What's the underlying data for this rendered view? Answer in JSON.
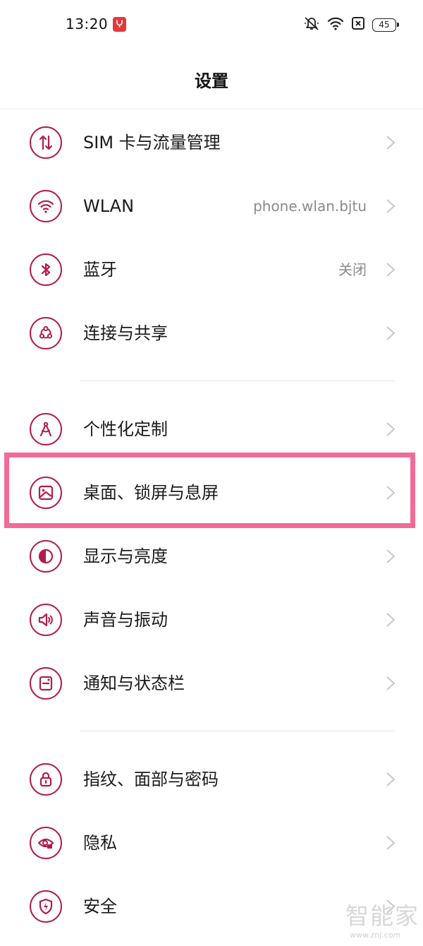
{
  "status_bar": {
    "time": "13:20",
    "battery": "45"
  },
  "header": {
    "title": "设置"
  },
  "colors": {
    "accent": "#b01c4e",
    "highlight": "#f26b97"
  },
  "settings": {
    "items": [
      {
        "label": "SIM 卡与流量管理",
        "icon": "sim-data-icon"
      },
      {
        "label": "WLAN",
        "value": "phone.wlan.bjtu",
        "icon": "wifi-icon"
      },
      {
        "label": "蓝牙",
        "value": "关闭",
        "icon": "bluetooth-icon"
      },
      {
        "label": "连接与共享",
        "icon": "share-icon"
      },
      {
        "label": "个性化定制",
        "icon": "compass-icon"
      },
      {
        "label": "桌面、锁屏与息屏",
        "icon": "wallpaper-icon"
      },
      {
        "label": "显示与亮度",
        "icon": "brightness-icon"
      },
      {
        "label": "声音与振动",
        "icon": "speaker-icon"
      },
      {
        "label": "通知与状态栏",
        "icon": "notification-icon"
      },
      {
        "label": "指纹、面部与密码",
        "icon": "lock-icon"
      },
      {
        "label": "隐私",
        "icon": "privacy-eye-icon"
      },
      {
        "label": "安全",
        "icon": "shield-icon"
      }
    ]
  },
  "watermark": {
    "text": "智能家",
    "url": "www.znj.com"
  }
}
